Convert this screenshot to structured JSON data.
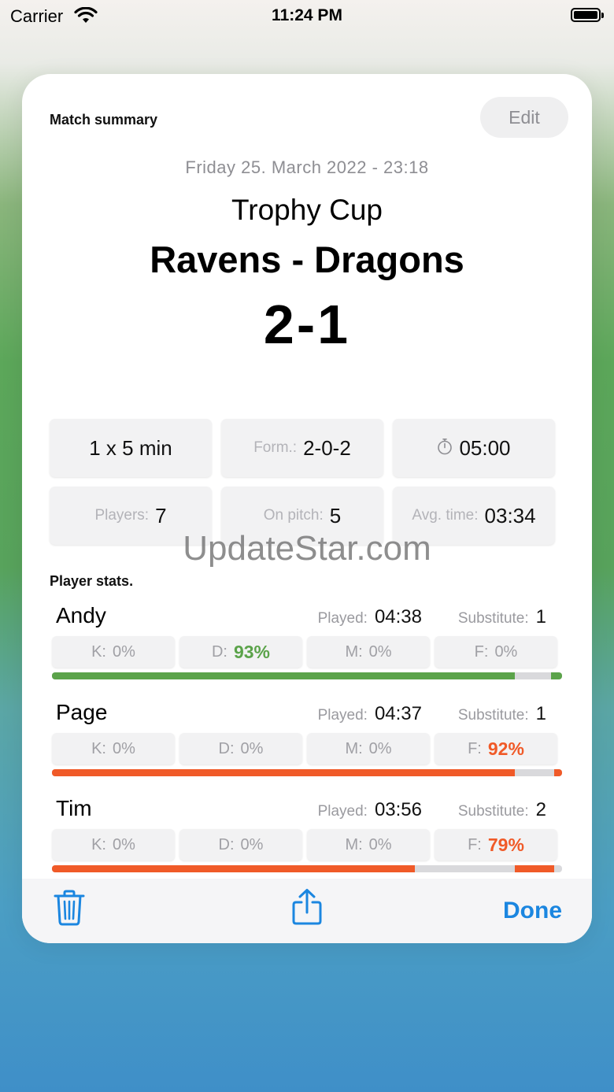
{
  "status_bar": {
    "carrier": "Carrier",
    "time": "11:24 PM"
  },
  "sheet": {
    "title": "Match summary",
    "edit_label": "Edit",
    "date": "Friday 25. March 2022 - 23:18",
    "competition": "Trophy Cup",
    "teams": "Ravens - Dragons",
    "score": "2-1"
  },
  "info_tiles": {
    "periods": "1 x 5 min",
    "formation": {
      "label": "Form.:",
      "value": "2-0-2"
    },
    "timer": {
      "icon": "stopwatch-icon",
      "value": "05:00"
    },
    "players": {
      "label": "Players:",
      "value": "7"
    },
    "on_pitch": {
      "label": "On pitch:",
      "value": "5"
    },
    "avg_time": {
      "label": "Avg. time:",
      "value": "03:34"
    }
  },
  "player_stats": {
    "title": "Player stats.",
    "played_label": "Played:",
    "substitute_label": "Substitute:",
    "players": [
      {
        "name": "Andy",
        "played": "04:38",
        "substitute": "1",
        "positions": [
          {
            "label": "K:",
            "value": "0%"
          },
          {
            "label": "D:",
            "value": "93%"
          },
          {
            "label": "M:",
            "value": "0%"
          },
          {
            "label": "F:",
            "value": "0%"
          }
        ]
      },
      {
        "name": "Page",
        "played": "04:37",
        "substitute": "1",
        "positions": [
          {
            "label": "K:",
            "value": "0%"
          },
          {
            "label": "D:",
            "value": "0%"
          },
          {
            "label": "M:",
            "value": "0%"
          },
          {
            "label": "F:",
            "value": "92%"
          }
        ]
      },
      {
        "name": "Tim",
        "played": "03:56",
        "substitute": "2",
        "positions": [
          {
            "label": "K:",
            "value": "0%"
          },
          {
            "label": "D:",
            "value": "0%"
          },
          {
            "label": "M:",
            "value": "0%"
          },
          {
            "label": "F:",
            "value": "79%"
          }
        ]
      }
    ]
  },
  "toolbar": {
    "delete_icon": "trash-icon",
    "share_icon": "share-icon",
    "done_label": "Done"
  },
  "watermark": "UpdateStar.com",
  "colors": {
    "accent_blue": "#1b86e0",
    "defense_green": "#5ba34a",
    "forward_orange": "#f05a28",
    "bar_gray": "#d9d9dc"
  }
}
